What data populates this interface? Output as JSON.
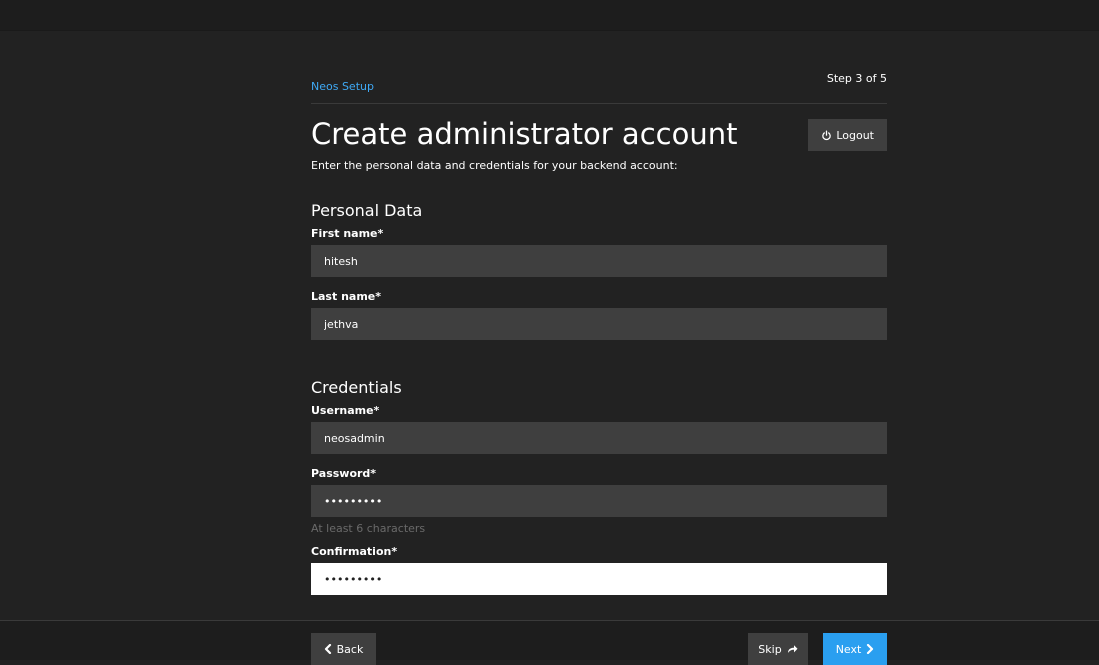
{
  "header": {
    "brand": "Neos Setup",
    "step": "Step 3 of 5",
    "title": "Create administrator account",
    "logout_label": "Logout",
    "intro": "Enter the personal data and credentials for your backend account:"
  },
  "personal": {
    "section_title": "Personal Data",
    "first_name_label": "First name*",
    "first_name_value": "hitesh",
    "last_name_label": "Last name*",
    "last_name_value": "jethva"
  },
  "credentials": {
    "section_title": "Credentials",
    "username_label": "Username*",
    "username_value": "neosadmin",
    "password_label": "Password*",
    "password_value": "•••••••••",
    "password_hint": "At least 6 characters",
    "confirmation_label": "Confirmation*",
    "confirmation_value": "•••••••••"
  },
  "footer": {
    "back_label": "Back",
    "skip_label": "Skip",
    "next_label": "Next"
  },
  "colors": {
    "accent": "#3fa9f5",
    "next_button": "#2a9ff0",
    "background": "#222222",
    "input_background": "#3f3f3f"
  },
  "icons": {
    "logout": "power-icon",
    "back": "chevron-left-icon",
    "skip": "share-arrow-icon",
    "next": "chevron-right-icon"
  }
}
